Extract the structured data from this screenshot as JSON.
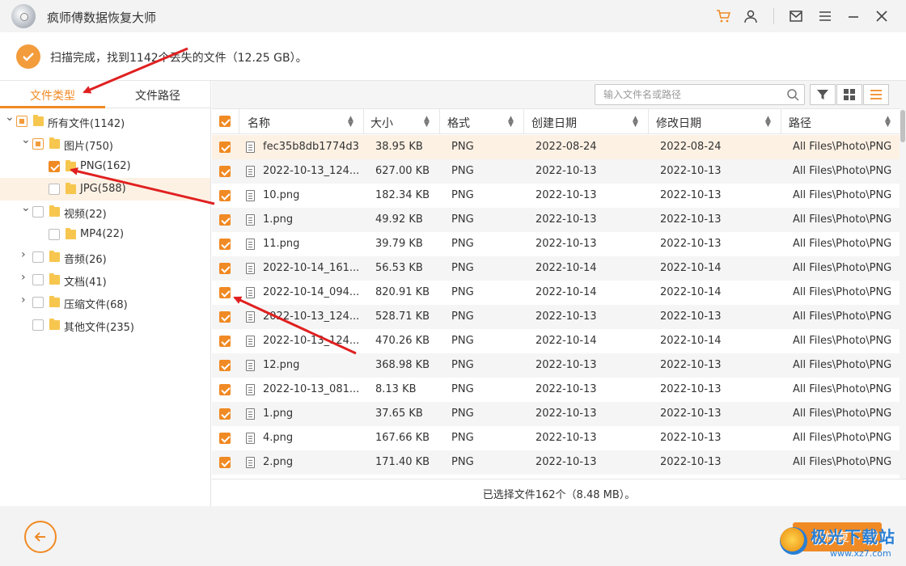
{
  "app": {
    "title": "疯师傅数据恢复大师"
  },
  "status": {
    "message": "扫描完成，找到1142个丢失的文件（12.25 GB）。"
  },
  "left_tabs": [
    {
      "label": "文件类型",
      "active": true
    },
    {
      "label": "文件路径",
      "active": false
    }
  ],
  "tree": [
    {
      "label": "所有文件(1142)",
      "level": 0,
      "expand": "down",
      "state": "partial",
      "highlight": false
    },
    {
      "label": "图片(750)",
      "level": 1,
      "expand": "down",
      "state": "partial",
      "highlight": false
    },
    {
      "label": "PNG(162)",
      "level": 2,
      "expand": "none",
      "state": "checked",
      "highlight": false
    },
    {
      "label": "JPG(588)",
      "level": 2,
      "expand": "none",
      "state": "unchecked",
      "highlight": true
    },
    {
      "label": "视频(22)",
      "level": 1,
      "expand": "down",
      "state": "unchecked",
      "highlight": false
    },
    {
      "label": "MP4(22)",
      "level": 2,
      "expand": "none",
      "state": "unchecked",
      "highlight": false
    },
    {
      "label": "音频(26)",
      "level": 1,
      "expand": "right",
      "state": "unchecked",
      "highlight": false
    },
    {
      "label": "文档(41)",
      "level": 1,
      "expand": "right",
      "state": "unchecked",
      "highlight": false
    },
    {
      "label": "压缩文件(68)",
      "level": 1,
      "expand": "right",
      "state": "unchecked",
      "highlight": false
    },
    {
      "label": "其他文件(235)",
      "level": 1,
      "expand": "none",
      "state": "unchecked",
      "highlight": false
    }
  ],
  "search": {
    "placeholder": "输入文件名或路径"
  },
  "columns": [
    "名称",
    "大小",
    "格式",
    "创建日期",
    "修改日期",
    "路径"
  ],
  "files": [
    {
      "name": "fec35b8db1774d3...",
      "size": "38.95 KB",
      "format": "PNG",
      "created": "2022-08-24",
      "modified": "2022-08-24",
      "path": "All Files\\Photo\\PNG"
    },
    {
      "name": "2022-10-13_124...",
      "size": "627.00 KB",
      "format": "PNG",
      "created": "2022-10-13",
      "modified": "2022-10-13",
      "path": "All Files\\Photo\\PNG"
    },
    {
      "name": "10.png",
      "size": "182.34 KB",
      "format": "PNG",
      "created": "2022-10-13",
      "modified": "2022-10-13",
      "path": "All Files\\Photo\\PNG"
    },
    {
      "name": "1.png",
      "size": "49.92 KB",
      "format": "PNG",
      "created": "2022-10-13",
      "modified": "2022-10-13",
      "path": "All Files\\Photo\\PNG"
    },
    {
      "name": "11.png",
      "size": "39.79 KB",
      "format": "PNG",
      "created": "2022-10-13",
      "modified": "2022-10-13",
      "path": "All Files\\Photo\\PNG"
    },
    {
      "name": "2022-10-14_161...",
      "size": "56.53 KB",
      "format": "PNG",
      "created": "2022-10-14",
      "modified": "2022-10-14",
      "path": "All Files\\Photo\\PNG"
    },
    {
      "name": "2022-10-14_094...",
      "size": "820.91 KB",
      "format": "PNG",
      "created": "2022-10-14",
      "modified": "2022-10-14",
      "path": "All Files\\Photo\\PNG"
    },
    {
      "name": "2022-10-13_124...",
      "size": "528.71 KB",
      "format": "PNG",
      "created": "2022-10-13",
      "modified": "2022-10-13",
      "path": "All Files\\Photo\\PNG"
    },
    {
      "name": "2022-10-13_124...",
      "size": "470.26 KB",
      "format": "PNG",
      "created": "2022-10-14",
      "modified": "2022-10-14",
      "path": "All Files\\Photo\\PNG"
    },
    {
      "name": "12.png",
      "size": "368.98 KB",
      "format": "PNG",
      "created": "2022-10-13",
      "modified": "2022-10-13",
      "path": "All Files\\Photo\\PNG"
    },
    {
      "name": "2022-10-13_081...",
      "size": "8.13 KB",
      "format": "PNG",
      "created": "2022-10-13",
      "modified": "2022-10-13",
      "path": "All Files\\Photo\\PNG"
    },
    {
      "name": "1.png",
      "size": "37.65 KB",
      "format": "PNG",
      "created": "2022-10-13",
      "modified": "2022-10-13",
      "path": "All Files\\Photo\\PNG"
    },
    {
      "name": "4.png",
      "size": "167.66 KB",
      "format": "PNG",
      "created": "2022-10-13",
      "modified": "2022-10-13",
      "path": "All Files\\Photo\\PNG"
    },
    {
      "name": "2.png",
      "size": "171.40 KB",
      "format": "PNG",
      "created": "2022-10-13",
      "modified": "2022-10-13",
      "path": "All Files\\Photo\\PNG"
    }
  ],
  "selection": {
    "summary": "已选择文件162个（8.48 MB）。"
  },
  "footer": {
    "recover_label": "恢复"
  },
  "watermark": {
    "text": "极光下载站",
    "url": "www.xz7.com"
  },
  "colors": {
    "accent": "#f08a24",
    "annotation_arrow": "#e02020"
  }
}
